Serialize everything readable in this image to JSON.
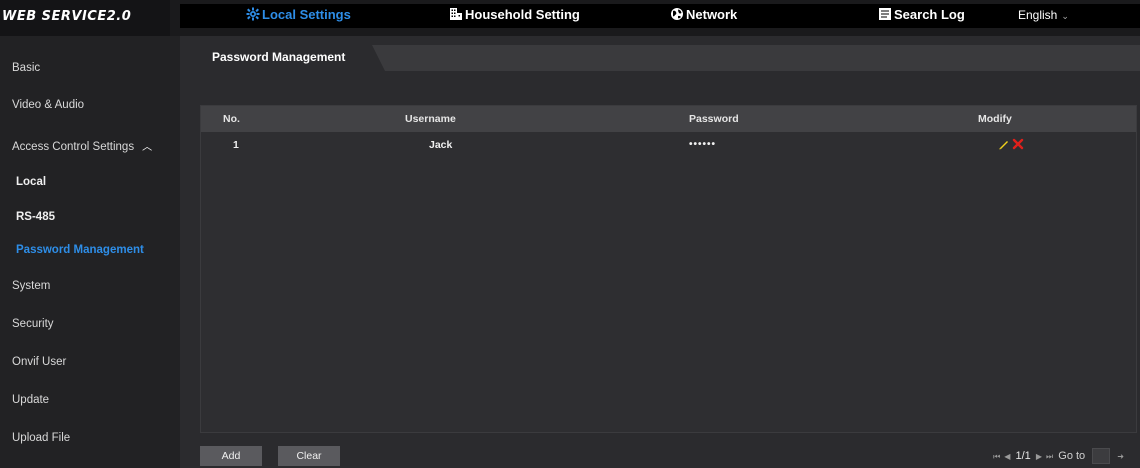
{
  "app": {
    "logo": "WEB SERVICE2.0"
  },
  "nav": {
    "items": [
      {
        "label": "Local Settings",
        "icon": "gear-icon",
        "active": true
      },
      {
        "label": "Household Setting",
        "icon": "building-icon",
        "active": false
      },
      {
        "label": "Network",
        "icon": "globe-icon",
        "active": false
      },
      {
        "label": "Search Log",
        "icon": "log-icon",
        "active": false
      }
    ],
    "language": "English"
  },
  "sidebar": {
    "items": [
      {
        "label": "Basic"
      },
      {
        "label": "Video & Audio"
      },
      {
        "label": "Access Control Settings",
        "expanded": true
      },
      {
        "label": "Local"
      },
      {
        "label": "RS-485"
      },
      {
        "label": "Password Management",
        "active": true
      },
      {
        "label": "System"
      },
      {
        "label": "Security"
      },
      {
        "label": "Onvif User"
      },
      {
        "label": "Update"
      },
      {
        "label": "Upload File"
      }
    ]
  },
  "main": {
    "tab": "Password Management",
    "table": {
      "columns": [
        "No.",
        "Username",
        "Password",
        "Modify"
      ],
      "rows": [
        {
          "no": "1",
          "username": "Jack",
          "password": "••••••"
        }
      ]
    },
    "buttons": {
      "add": "Add",
      "clear": "Clear"
    },
    "pager": {
      "page": "1/1",
      "goto_label": "Go to"
    }
  },
  "colors": {
    "accent": "#2e8ee8",
    "edit": "#f2d21b",
    "delete": "#e0201b"
  }
}
